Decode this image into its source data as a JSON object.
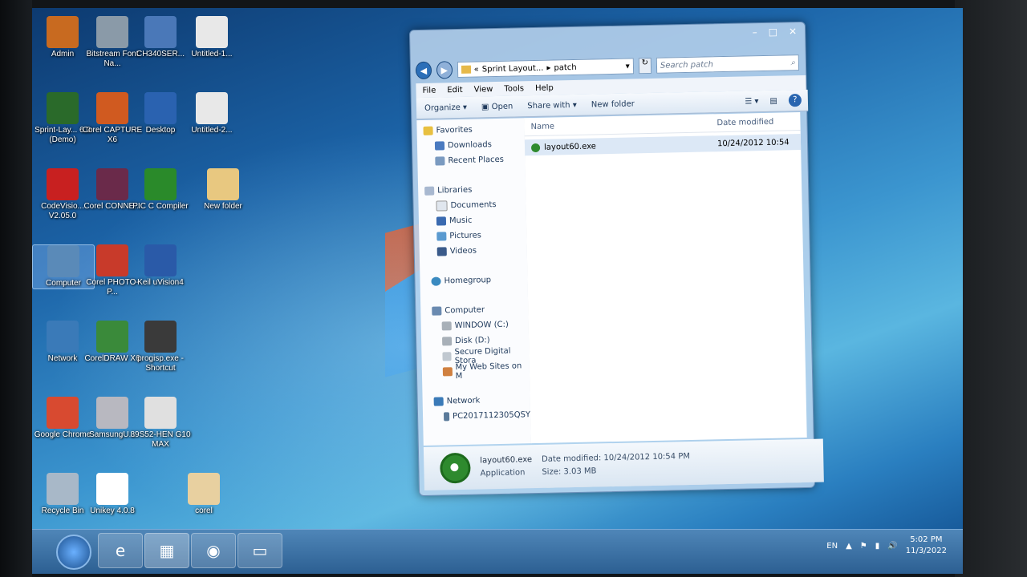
{
  "desktop_icons": [
    {
      "label": "Admin",
      "glyph": "folder-icon",
      "color": "#c86a20"
    },
    {
      "label": "Bitstream Font Na...",
      "glyph": "pen-icon",
      "color": "#8a9aa8"
    },
    {
      "label": "CH340SER...",
      "glyph": "network-driver-icon",
      "color": "#4a78b8"
    },
    {
      "label": "Untitled-1...",
      "glyph": "document-icon",
      "color": "#e8e8e8"
    },
    {
      "label": "Sprint-Lay... 6.0 (Demo)",
      "glyph": "sprint-layout-icon",
      "color": "#2a6a2a"
    },
    {
      "label": "Corel CAPTURE X6",
      "glyph": "corel-capture-icon",
      "color": "#d05a20"
    },
    {
      "label": "Desktop",
      "glyph": "desktop-icon",
      "color": "#2a62b0"
    },
    {
      "label": "Untitled-2...",
      "glyph": "document-icon",
      "color": "#e8e8e8"
    },
    {
      "label": "CodeVisio... V2.05.0",
      "glyph": "codevision-icon",
      "color": "#c82020"
    },
    {
      "label": "Corel CONNE...",
      "glyph": "corel-connect-icon",
      "color": "#6a2a4a"
    },
    {
      "label": "PIC C Compiler",
      "glyph": "pic-c-icon",
      "color": "#2a8a2a"
    },
    {
      "label": "New folder",
      "glyph": "folder-icon",
      "color": "#e8c880"
    },
    {
      "label": "Computer",
      "glyph": "computer-icon",
      "color": "#5a8ab8"
    },
    {
      "label": "Corel PHOTO-P...",
      "glyph": "camera-icon",
      "color": "#c83a2a"
    },
    {
      "label": "Keil uVision4",
      "glyph": "keil-icon",
      "color": "#2a5aa8"
    },
    {
      "label": "Network",
      "glyph": "network-icon",
      "color": "#3a7ab8"
    },
    {
      "label": "CorelDRAW X6",
      "glyph": "coreldraw-icon",
      "color": "#3a8a3a"
    },
    {
      "label": "progisp.exe - Shortcut",
      "glyph": "chip-icon",
      "color": "#3a3a3a"
    },
    {
      "label": "Google Chrome",
      "glyph": "chrome-icon",
      "color": "#d84a30"
    },
    {
      "label": "SamsungU...",
      "glyph": "disc-icon",
      "color": "#b8b8c0"
    },
    {
      "label": "89S52-HEN G10 MAX",
      "glyph": "image-file-icon",
      "color": "#e0e0e0"
    },
    {
      "label": "Recycle Bin",
      "glyph": "recycle-bin-icon",
      "color": "#a8b8c8"
    },
    {
      "label": "Unikey 4.0.8",
      "glyph": "unikey-icon",
      "color": "#ffffff"
    },
    {
      "label": "corel",
      "glyph": "folder-icon",
      "color": "#e8d0a0"
    }
  ],
  "explorer": {
    "window_controls": {
      "minimize": "–",
      "maximize": "□",
      "close": "✕"
    },
    "breadcrumb": {
      "prefix": "«",
      "parent": "Sprint Layout...",
      "sep": "▸",
      "current": "patch"
    },
    "search_placeholder": "Search patch",
    "menu": [
      "File",
      "Edit",
      "View",
      "Tools",
      "Help"
    ],
    "toolbar": {
      "organize": "Organize ▾",
      "open": "Open",
      "share": "Share with ▾",
      "new_folder": "New folder"
    },
    "nav": {
      "favorites": {
        "title": "Favorites",
        "items": [
          "Downloads",
          "Recent Places"
        ]
      },
      "libraries": {
        "title": "Libraries",
        "items": [
          "Documents",
          "Music",
          "Pictures",
          "Videos"
        ]
      },
      "homegroup": "Homegroup",
      "computer": {
        "title": "Computer",
        "items": [
          "WINDOW (C:)",
          "Disk (D:)",
          "Secure Digital Stora",
          "My Web Sites on M"
        ]
      },
      "network": {
        "title": "Network",
        "items": [
          "PC2017112305QSY"
        ]
      }
    },
    "columns": {
      "name": "Name",
      "date": "Date modified"
    },
    "files": [
      {
        "name": "layout60.exe",
        "date": "10/24/2012 10:54"
      }
    ],
    "details": {
      "filename": "layout60.exe",
      "type": "Application",
      "date_label": "Date modified:",
      "date_value": "10/24/2012 10:54 PM",
      "size_label": "Size:",
      "size_value": "3.03 MB"
    }
  },
  "taskbar": {
    "items": [
      "ie-icon",
      "explorer-icon",
      "chrome-icon",
      "window-icon"
    ],
    "language": "EN",
    "time": "5:02 PM",
    "date": "11/3/2022"
  }
}
